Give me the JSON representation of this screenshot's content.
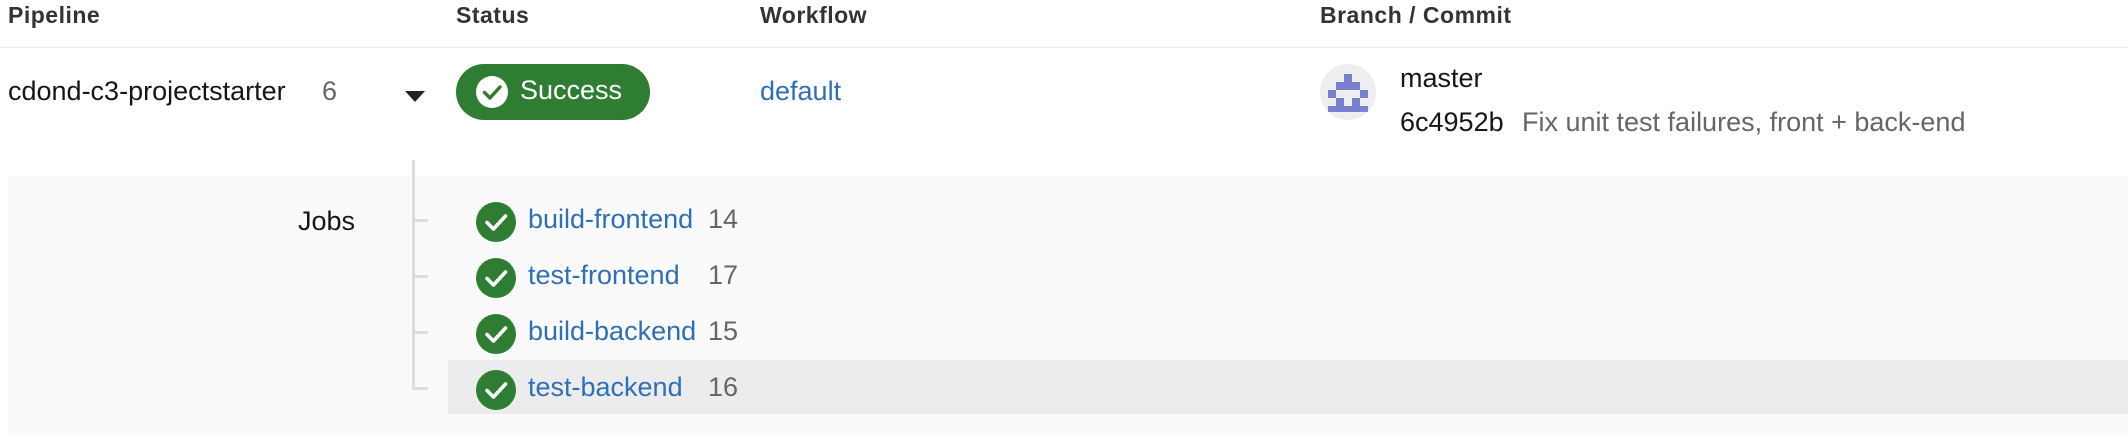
{
  "header": {
    "pipeline": "Pipeline",
    "status": "Status",
    "workflow": "Workflow",
    "branch_commit": "Branch / Commit"
  },
  "pipeline": {
    "name": "cdond-c3-projectstarter",
    "number": "6",
    "status": "Success",
    "status_color": "#2e7d32",
    "workflow": "default",
    "branch": "master",
    "commit_hash": "6c4952b",
    "commit_message": "Fix unit test failures, front + back-end"
  },
  "jobs": {
    "label": "Jobs",
    "items": [
      {
        "name": "build-frontend",
        "number": "14",
        "status": "success"
      },
      {
        "name": "test-frontend",
        "number": "17",
        "status": "success"
      },
      {
        "name": "build-backend",
        "number": "15",
        "status": "success"
      },
      {
        "name": "test-backend",
        "number": "16",
        "status": "success"
      }
    ]
  },
  "icons": {
    "expand": "chevron-down-icon",
    "success": "check-circle-icon",
    "avatar": "user-avatar"
  },
  "colors": {
    "link": "#2f6fb7",
    "success": "#2e7d32"
  }
}
